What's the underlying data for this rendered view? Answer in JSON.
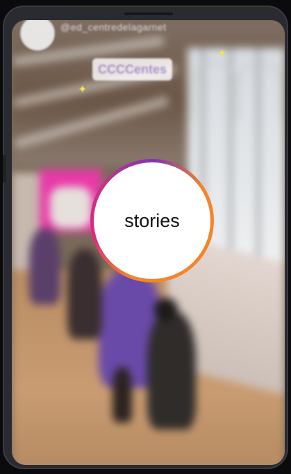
{
  "header": {
    "username": "@ed_centredelagarnet",
    "avatar_icon": "avatar-icon"
  },
  "tag": {
    "label": "CCCCentes"
  },
  "story": {
    "label": "stories"
  },
  "colors": {
    "ring_start": "#f58529",
    "ring_mid": "#dd2a7b",
    "ring_end": "#8134af",
    "tag_text": "#a993c9",
    "pink_wall": "#e83aa6"
  }
}
